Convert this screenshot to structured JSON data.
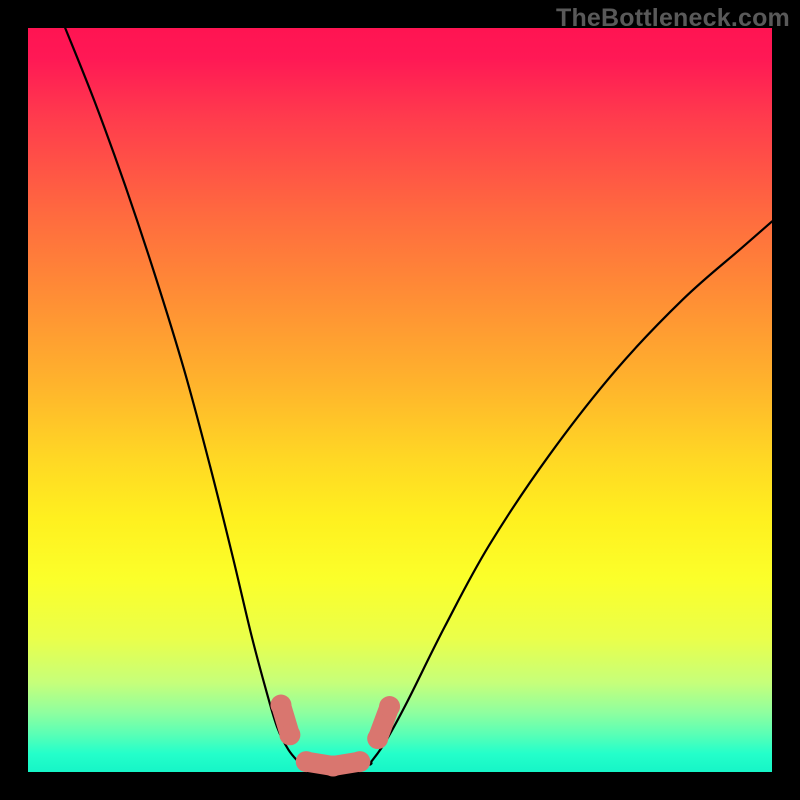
{
  "watermark": "TheBottleneck.com",
  "colors": {
    "frame": "#000000",
    "curve": "#000000",
    "marker": "#d9766f",
    "gradient_top": "#ff1452",
    "gradient_bottom": "#16f5c7"
  },
  "chart_data": {
    "type": "line",
    "title": "",
    "xlabel": "",
    "ylabel": "",
    "xlim": [
      0,
      1
    ],
    "ylim": [
      0,
      1
    ],
    "annotations": [
      "TheBottleneck.com"
    ],
    "series": [
      {
        "name": "left_branch",
        "x": [
          0.05,
          0.09,
          0.13,
          0.17,
          0.21,
          0.245,
          0.275,
          0.3,
          0.32,
          0.335,
          0.35,
          0.365
        ],
        "y": [
          1.0,
          0.9,
          0.79,
          0.67,
          0.54,
          0.41,
          0.29,
          0.185,
          0.11,
          0.06,
          0.03,
          0.012
        ]
      },
      {
        "name": "valley_floor",
        "x": [
          0.365,
          0.395,
          0.43,
          0.46
        ],
        "y": [
          0.012,
          0.006,
          0.006,
          0.012
        ]
      },
      {
        "name": "right_branch",
        "x": [
          0.46,
          0.48,
          0.51,
          0.56,
          0.62,
          0.7,
          0.79,
          0.88,
          0.96,
          1.0
        ],
        "y": [
          0.012,
          0.04,
          0.095,
          0.195,
          0.305,
          0.425,
          0.54,
          0.635,
          0.705,
          0.74
        ]
      }
    ],
    "markers": [
      {
        "name": "left_highlight_top",
        "x": 0.34,
        "y": 0.09
      },
      {
        "name": "left_highlight_mid",
        "x": 0.352,
        "y": 0.05
      },
      {
        "name": "valley_left",
        "x": 0.374,
        "y": 0.014
      },
      {
        "name": "valley_mid",
        "x": 0.41,
        "y": 0.008
      },
      {
        "name": "valley_right",
        "x": 0.446,
        "y": 0.014
      },
      {
        "name": "right_highlight_low",
        "x": 0.47,
        "y": 0.045
      },
      {
        "name": "right_highlight_high",
        "x": 0.486,
        "y": 0.088
      }
    ],
    "grid": false,
    "legend": false,
    "background": "vertical-gradient red→orange→yellow→green"
  }
}
